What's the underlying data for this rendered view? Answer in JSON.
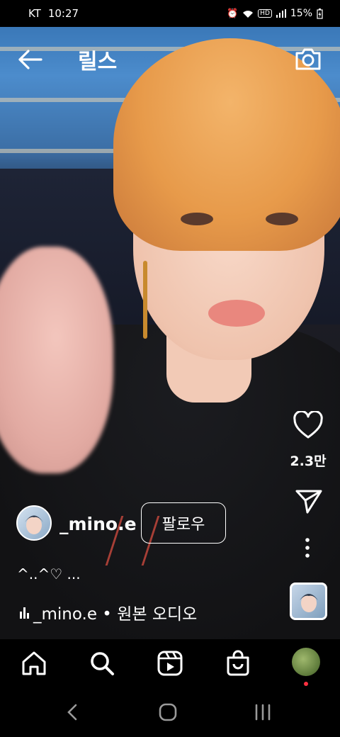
{
  "status_bar": {
    "carrier": "KT",
    "time": "10:27",
    "battery": "15%",
    "icons": [
      "alarm-icon",
      "wifi-icon",
      "hd-icon",
      "signal-icon",
      "battery-charging-icon"
    ]
  },
  "header": {
    "title": "릴스",
    "back_icon": "arrow-left-icon",
    "camera_icon": "camera-icon"
  },
  "reel": {
    "like_count": "2.3만",
    "username": "_mino.e",
    "follow_label": "팔로우",
    "caption": "^..^♡ ...",
    "audio_label": "_mino.e • 원본 오디오"
  },
  "bottom_nav": {
    "items": [
      "home-icon",
      "search-icon",
      "reels-icon",
      "shop-icon",
      "profile-avatar"
    ]
  },
  "system_nav": {
    "items": [
      "back-icon",
      "home-circle-icon",
      "recents-icon"
    ]
  },
  "colors": {
    "background": "#000000",
    "text": "#ffffff",
    "notification_dot": "#ff3040"
  }
}
